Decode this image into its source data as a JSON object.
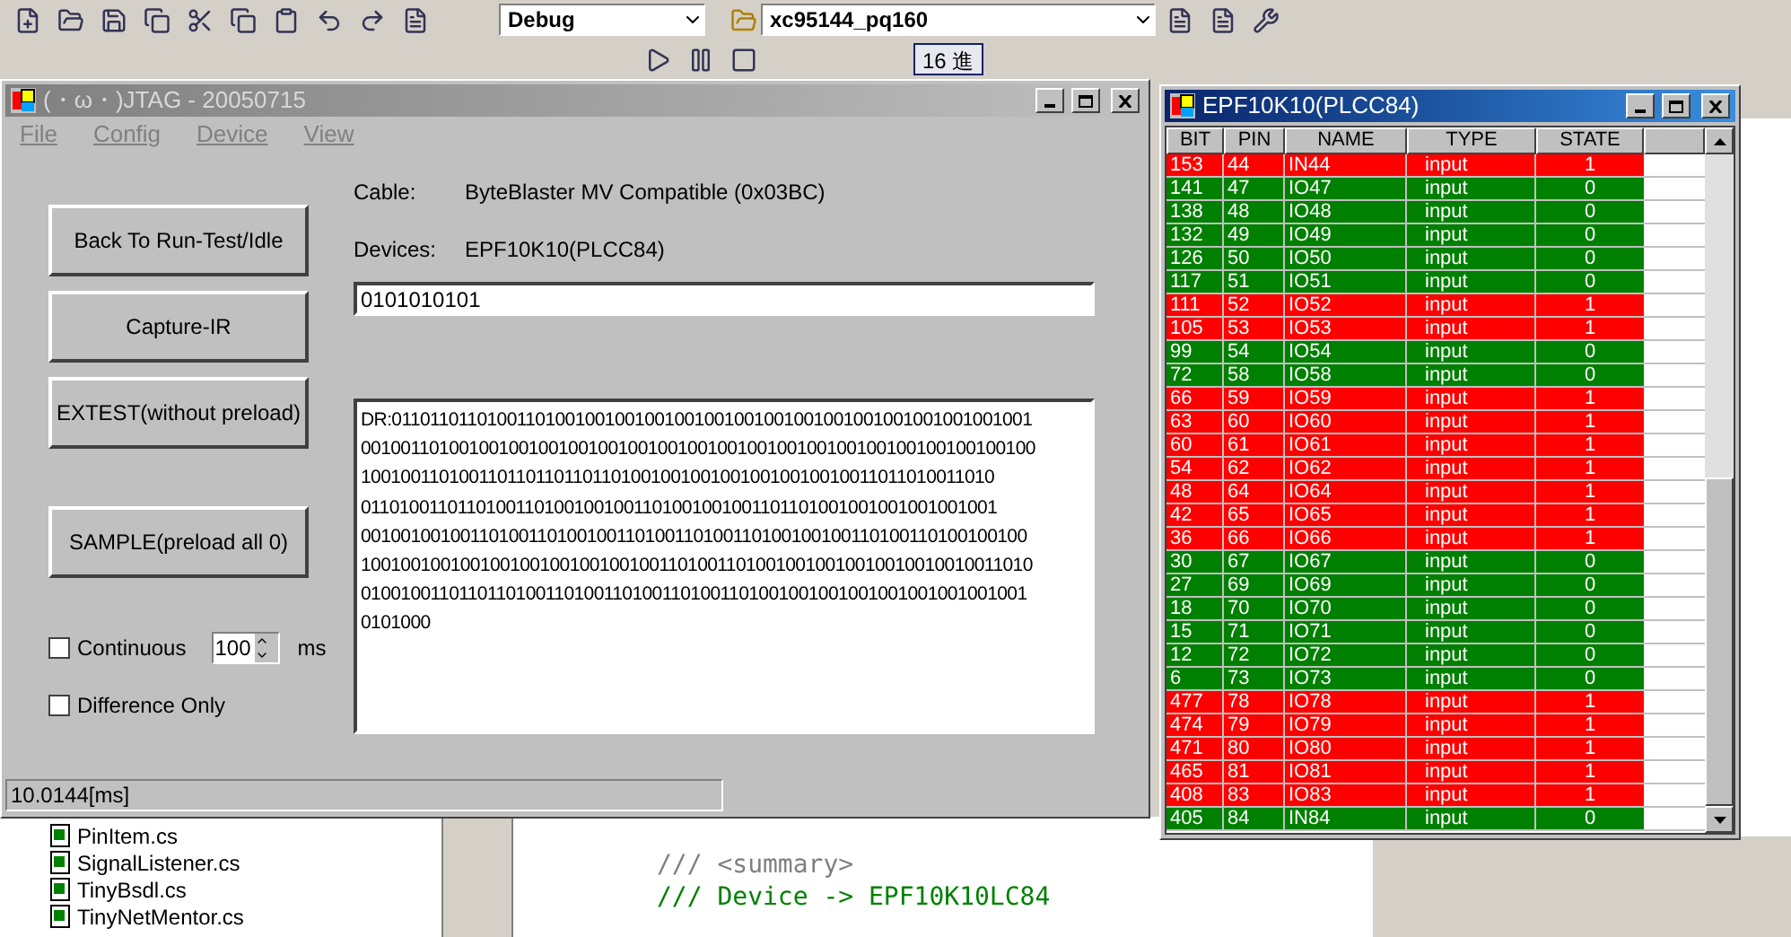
{
  "ide": {
    "configuration": "Debug",
    "project": "xc95144_pq160",
    "radix_button": "16 進",
    "files": [
      "PinItem.cs",
      "SignalListener.cs",
      "TinyBsdl.cs",
      "TinyNetMentor.cs"
    ],
    "code_lines": [
      {
        "text": "/// <summary>",
        "kind": "comment-tag"
      },
      {
        "text": "/// Device -> EPF10K10LC84",
        "kind": "comment"
      }
    ]
  },
  "jtag_window": {
    "title": "(・ω・)JTAG - 20050715",
    "menu": [
      "File",
      "Config",
      "Device",
      "View"
    ],
    "buttons": [
      "Back To Run-Test/Idle",
      "Capture-IR",
      "EXTEST(without preload)",
      "SAMPLE(preload all 0)"
    ],
    "cable_label": "Cable:",
    "cable": "ByteBlaster MV Compatible (0x03BC)",
    "devices_label": "Devices:",
    "device": "EPF10K10(PLCC84)",
    "ir_value": "0101010101",
    "dr_lines": [
      "DR:01101101101001101001001001001001001001001001001001001001001001001",
      "00100110100100100100100100100100100100100100100100100100100100100100",
      "10010011010011011011011011010010010010010010010010011011010011010",
      "01101001101101001101001001001101001001001101101001001001001001001",
      "00100100100110100110100100110100110100110100100100110100110100100100",
      "10010010010010010010010010010011010011010010010010010010010010011010",
      "01001001101101101001101001101001101001101001001001001001001001001001",
      "0101000"
    ],
    "options": [
      {
        "label": "Continuous",
        "checked": false
      },
      {
        "label": "Difference Only",
        "checked": false
      }
    ],
    "interval": "100",
    "interval_unit": "ms",
    "status": "10.0144[ms]"
  },
  "pin_window": {
    "title": "EPF10K10(PLCC84)",
    "columns": [
      "BIT",
      "PIN",
      "NAME",
      "TYPE",
      "STATE"
    ],
    "rows": [
      {
        "bit": "153",
        "pin": "44",
        "name": "IN44",
        "type": "input",
        "state": "1",
        "color": "#ff0000"
      },
      {
        "bit": "141",
        "pin": "47",
        "name": "IO47",
        "type": "input",
        "state": "0",
        "color": "#008000"
      },
      {
        "bit": "138",
        "pin": "48",
        "name": "IO48",
        "type": "input",
        "state": "0",
        "color": "#008000"
      },
      {
        "bit": "132",
        "pin": "49",
        "name": "IO49",
        "type": "input",
        "state": "0",
        "color": "#008000"
      },
      {
        "bit": "126",
        "pin": "50",
        "name": "IO50",
        "type": "input",
        "state": "0",
        "color": "#008000"
      },
      {
        "bit": "117",
        "pin": "51",
        "name": "IO51",
        "type": "input",
        "state": "0",
        "color": "#008000"
      },
      {
        "bit": "111",
        "pin": "52",
        "name": "IO52",
        "type": "input",
        "state": "1",
        "color": "#ff0000"
      },
      {
        "bit": "105",
        "pin": "53",
        "name": "IO53",
        "type": "input",
        "state": "1",
        "color": "#ff0000"
      },
      {
        "bit": "99",
        "pin": "54",
        "name": "IO54",
        "type": "input",
        "state": "0",
        "color": "#008000"
      },
      {
        "bit": "72",
        "pin": "58",
        "name": "IO58",
        "type": "input",
        "state": "0",
        "color": "#008000"
      },
      {
        "bit": "66",
        "pin": "59",
        "name": "IO59",
        "type": "input",
        "state": "1",
        "color": "#ff0000"
      },
      {
        "bit": "63",
        "pin": "60",
        "name": "IO60",
        "type": "input",
        "state": "1",
        "color": "#ff0000"
      },
      {
        "bit": "60",
        "pin": "61",
        "name": "IO61",
        "type": "input",
        "state": "1",
        "color": "#ff0000"
      },
      {
        "bit": "54",
        "pin": "62",
        "name": "IO62",
        "type": "input",
        "state": "1",
        "color": "#ff0000"
      },
      {
        "bit": "48",
        "pin": "64",
        "name": "IO64",
        "type": "input",
        "state": "1",
        "color": "#ff0000"
      },
      {
        "bit": "42",
        "pin": "65",
        "name": "IO65",
        "type": "input",
        "state": "1",
        "color": "#ff0000"
      },
      {
        "bit": "36",
        "pin": "66",
        "name": "IO66",
        "type": "input",
        "state": "1",
        "color": "#ff0000"
      },
      {
        "bit": "30",
        "pin": "67",
        "name": "IO67",
        "type": "input",
        "state": "0",
        "color": "#008000"
      },
      {
        "bit": "27",
        "pin": "69",
        "name": "IO69",
        "type": "input",
        "state": "0",
        "color": "#008000"
      },
      {
        "bit": "18",
        "pin": "70",
        "name": "IO70",
        "type": "input",
        "state": "0",
        "color": "#008000"
      },
      {
        "bit": "15",
        "pin": "71",
        "name": "IO71",
        "type": "input",
        "state": "0",
        "color": "#008000"
      },
      {
        "bit": "12",
        "pin": "72",
        "name": "IO72",
        "type": "input",
        "state": "0",
        "color": "#008000"
      },
      {
        "bit": "6",
        "pin": "73",
        "name": "IO73",
        "type": "input",
        "state": "0",
        "color": "#008000"
      },
      {
        "bit": "477",
        "pin": "78",
        "name": "IO78",
        "type": "input",
        "state": "1",
        "color": "#ff0000"
      },
      {
        "bit": "474",
        "pin": "79",
        "name": "IO79",
        "type": "input",
        "state": "1",
        "color": "#ff0000"
      },
      {
        "bit": "471",
        "pin": "80",
        "name": "IO80",
        "type": "input",
        "state": "1",
        "color": "#ff0000"
      },
      {
        "bit": "465",
        "pin": "81",
        "name": "IO81",
        "type": "input",
        "state": "1",
        "color": "#ff0000"
      },
      {
        "bit": "408",
        "pin": "83",
        "name": "IO83",
        "type": "input",
        "state": "1",
        "color": "#ff0000"
      },
      {
        "bit": "405",
        "pin": "84",
        "name": "IN84",
        "type": "input",
        "state": "0",
        "color": "#008000"
      }
    ]
  }
}
